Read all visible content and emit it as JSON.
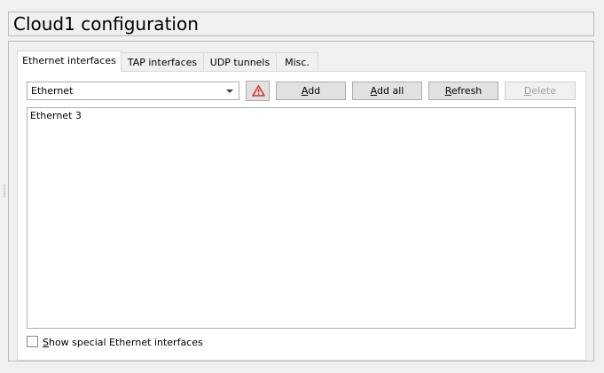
{
  "title": "Cloud1 configuration",
  "tabs": [
    {
      "label": "Ethernet interfaces",
      "active": true
    },
    {
      "label": "TAP interfaces",
      "active": false
    },
    {
      "label": "UDP tunnels",
      "active": false
    },
    {
      "label": "Misc.",
      "active": false
    }
  ],
  "ethernet": {
    "combo_value": "Ethernet",
    "warning_icon": "warning-triangle-icon",
    "buttons": {
      "add": {
        "label_mnemonic": "A",
        "label_rest": "dd"
      },
      "add_all": {
        "label_mnemonic": "A",
        "label_rest": "dd all"
      },
      "refresh": {
        "label_mnemonic": "R",
        "label_rest": "efresh"
      },
      "delete": {
        "label_mnemonic": "D",
        "label_rest": "elete",
        "enabled": false
      }
    },
    "interfaces": [
      "Ethernet 3"
    ],
    "show_special": {
      "label_mnemonic": "S",
      "label_rest": "how special Ethernet interfaces",
      "checked": false
    }
  },
  "colors": {
    "warning_red": "#d0342c",
    "button_face": "#e1e1e1",
    "window_bg": "#f0f0f0"
  }
}
